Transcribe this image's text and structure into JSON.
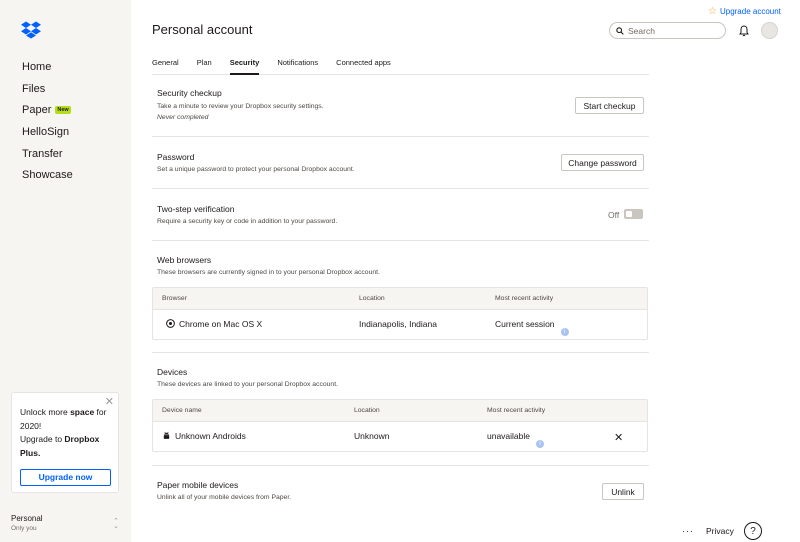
{
  "sidebar": {
    "items": [
      {
        "label": "Home"
      },
      {
        "label": "Files"
      },
      {
        "label": "Paper",
        "badge": "New"
      },
      {
        "label": "HelloSign"
      },
      {
        "label": "Transfer"
      },
      {
        "label": "Showcase"
      }
    ],
    "promo": {
      "line1_a": "Unlock more ",
      "line1_b": "space",
      "line1_c": " for 2020!",
      "line2_a": "Upgrade to ",
      "line2_b": "Dropbox Plus.",
      "button": "Upgrade now"
    },
    "account": {
      "name": "Personal",
      "sub": "Only you"
    }
  },
  "header": {
    "title": "Personal account",
    "upgrade_label": "Upgrade account",
    "search_placeholder": "Search"
  },
  "tabs": [
    {
      "label": "General"
    },
    {
      "label": "Plan"
    },
    {
      "label": "Security",
      "active": true
    },
    {
      "label": "Notifications"
    },
    {
      "label": "Connected apps"
    }
  ],
  "sections": {
    "checkup": {
      "title": "Security checkup",
      "desc": "Take a minute to review your Dropbox security settings.",
      "note": "Never completed",
      "button": "Start checkup"
    },
    "password": {
      "title": "Password",
      "desc": "Set a unique password to protect your personal Dropbox account.",
      "button": "Change password"
    },
    "two_step": {
      "title": "Two-step verification",
      "desc": "Require a security key or code in addition to your password.",
      "state": "Off"
    },
    "web_browsers": {
      "title": "Web browsers",
      "desc": "These browsers are currently signed in to your personal Dropbox account.",
      "columns": [
        "Browser",
        "Location",
        "Most recent activity"
      ],
      "rows": [
        {
          "name": "Chrome on Mac OS X",
          "location": "Indianapolis, Indiana",
          "activity": "Current session"
        }
      ]
    },
    "devices": {
      "title": "Devices",
      "desc": "These devices are linked to your personal Dropbox account.",
      "columns": [
        "Device name",
        "Location",
        "Most recent activity"
      ],
      "rows": [
        {
          "name": "Unknown Androids",
          "location": "Unknown",
          "activity": "unavailable"
        }
      ]
    },
    "paper_mobile": {
      "title": "Paper mobile devices",
      "desc": "Unlink all of your mobile devices from Paper.",
      "button": "Unlink"
    }
  },
  "footer": {
    "more": "···",
    "privacy": "Privacy",
    "help": "?"
  },
  "colors": {
    "accent": "#0061fe",
    "sidebar_bg": "#f7f5f2",
    "badge": "#b4dc19"
  }
}
